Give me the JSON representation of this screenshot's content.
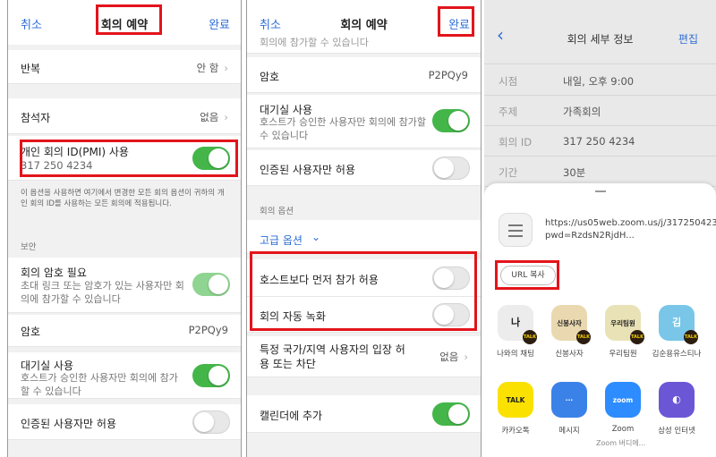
{
  "panel1": {
    "cancel": "취소",
    "title": "회의 예약",
    "done": "완료",
    "repeat_label": "반복",
    "repeat_value": "안 함",
    "attendees_label": "참석자",
    "attendees_value": "없음",
    "pmi_label": "개인 회의 ID(PMI) 사용",
    "pmi_value": "317 250 4234",
    "pmi_note": "이 옵션을 사용하면 여기에서 변경한 모든 회의 옵션이 귀하의 개인 회의 ID를 사용하는 모든 회의에 적용됩니다.",
    "security_section": "보안",
    "passcode_required_label": "회의 암호 필요",
    "passcode_required_sub": "초대 링크 또는 암호가 있는 사용자만 회의에 참가할 수 있습니다",
    "passcode_label": "암호",
    "passcode_value": "P2PQy9",
    "waiting_room_label": "대기실 사용",
    "waiting_room_sub": "호스트가 승인한 사용자만 회의에 참가할 수 있습니다",
    "auth_users_label": "인증된 사용자만 허용"
  },
  "panel2": {
    "cancel": "취소",
    "title": "회의 예약",
    "done": "완료",
    "top_partial": "회의에 참가할 수 있습니다",
    "passcode_label": "암호",
    "passcode_value": "P2PQy9",
    "waiting_room_label": "대기실 사용",
    "waiting_room_sub": "호스트가 승인한 사용자만 회의에 참가할 수 있습니다",
    "auth_users_label": "인증된 사용자만 허용",
    "meeting_options_section": "회의 옵션",
    "advanced_options": "고급 옵션",
    "join_before_host_label": "호스트보다 먼저 참가 허용",
    "auto_record_label": "회의 자동 녹화",
    "region_label": "특정 국가/지역 사용자의 입장 허용 또는 차단",
    "region_value": "없음",
    "calendar_label": "캘린더에 추가"
  },
  "panel3": {
    "title": "회의 세부 정보",
    "edit": "편집",
    "time_key": "시점",
    "time_value": "내일, 오후 9:00",
    "topic_key": "주제",
    "topic_value": "가족회의",
    "id_key": "회의 ID",
    "id_value": "317 250 4234",
    "duration_key": "기간",
    "duration_value": "30분",
    "url": "https://us05web.zoom.us/j/3172504234?pwd=RzdsN2RjdH...",
    "copy_url": "URL 복사",
    "share_row1": [
      {
        "name": "나와의 채팅",
        "glyph": "나",
        "color": "#ececec"
      },
      {
        "name": "신봉사자",
        "glyph": "신봉사자",
        "color": "#ead9b0"
      },
      {
        "name": "우리팀원",
        "glyph": "우리팀원",
        "color": "#e9e2b6"
      },
      {
        "name": "김순용유스티나",
        "glyph": "김",
        "color": "#79c6e8"
      }
    ],
    "share_row2": [
      {
        "name": "카카오톡",
        "glyph": "TALK",
        "color": "#fae100"
      },
      {
        "name": "메시지",
        "glyph": "···",
        "color": "#3b82e8"
      },
      {
        "name": "Zoom",
        "glyph": "zoom",
        "color": "#2d8cff"
      },
      {
        "name": "삼성 인터넷",
        "glyph": "◐",
        "color": "#6b56d6"
      }
    ],
    "zoom_sub": "Zoom 버디에..."
  }
}
